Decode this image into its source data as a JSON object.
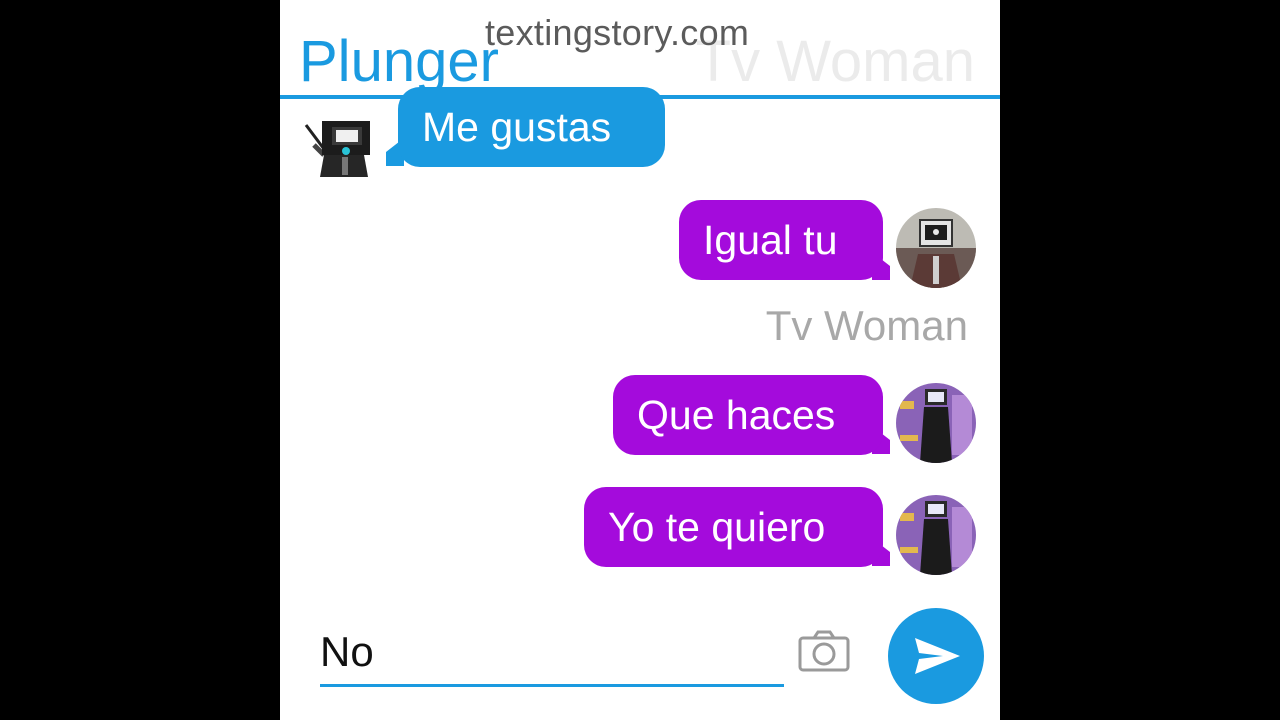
{
  "watermark": "textingstory.com",
  "header": {
    "left_name": "Plunger",
    "right_name": "Tv Woman"
  },
  "messages": [
    {
      "side": "left",
      "text": "Me gustas",
      "color": "#1a9ae0",
      "avatar": "plunger-avatar-icon"
    },
    {
      "side": "right",
      "text": "Igual tu",
      "color": "#a40bdc",
      "avatar": "tv-man-avatar-icon"
    },
    {
      "side": "right",
      "text": "Que haces",
      "color": "#a40bdc",
      "avatar": "tv-woman-avatar-icon"
    },
    {
      "side": "right",
      "text": "Yo te quiero",
      "color": "#a40bdc",
      "avatar": "tv-woman-avatar-icon"
    }
  ],
  "sender_label": "Tv Woman",
  "composer": {
    "value": "No",
    "camera_icon": "camera-icon",
    "send_icon": "send-arrow-icon"
  },
  "colors": {
    "accent": "#1a9ae0",
    "purple": "#a40bdc",
    "background": "#ffffff",
    "frame": "#000000"
  }
}
